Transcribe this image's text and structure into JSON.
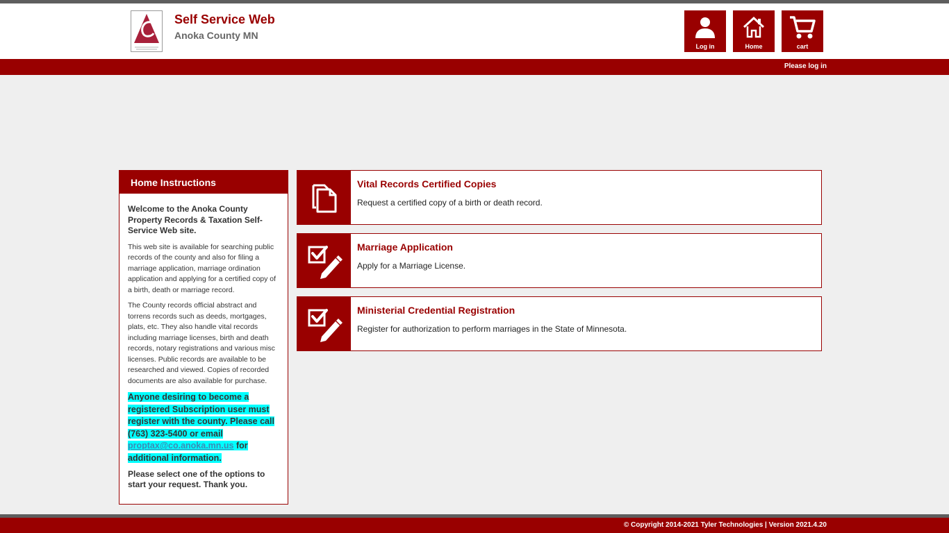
{
  "header": {
    "logo_text": "ANOKA COUNTY",
    "title": "Self Service Web",
    "subtitle": "Anoka County MN"
  },
  "nav": {
    "login": {
      "label": "Log in",
      "icon": "user-icon"
    },
    "home": {
      "label": "Home",
      "icon": "home-icon"
    },
    "cart": {
      "label": "cart",
      "icon": "cart-icon"
    }
  },
  "status": {
    "login_prompt": "Please log in"
  },
  "instructions": {
    "heading": "Home Instructions",
    "welcome": "Welcome to the Anoka County Property Records & Taxation Self-Service Web site.",
    "para1": "This web site is available for searching public records of the county and also for filing a marriage application, marriage ordination application and applying for a certified copy of a birth, death or marriage record.",
    "para2": "The County records official abstract and torrens records such as deeds, mortgages, plats, etc. They also handle vital records including marriage licenses, birth and death records, notary registrations and various misc licenses. Public records are available to be researched and viewed. Copies of recorded documents are also available for purchase.",
    "highlight_before": "Anyone desiring to become a registered Subscription user must register with the county. Please call (763) 323-5400 or email",
    "email": "proptax@co.anoka.mn.us",
    "highlight_after": "for additional information.",
    "closing": "Please select one of the options to start your request. Thank you."
  },
  "cards": [
    {
      "title": "Vital Records Certified Copies",
      "description": "Request a certified copy of a birth or death record.",
      "icon": "documents-icon"
    },
    {
      "title": "Marriage Application",
      "description": "Apply for a Marriage License.",
      "icon": "checkbox-pencil-icon"
    },
    {
      "title": "Ministerial Credential Registration",
      "description": "Register for authorization to perform marriages in the State of Minnesota.",
      "icon": "checkbox-pencil-icon"
    }
  ],
  "footer": {
    "copyright": "© Copyright 2014-2021 Tyler Technologies | Version 2021.4.20"
  },
  "colors": {
    "brand_red": "#990000",
    "highlight": "#00ffff",
    "background": "#efefef",
    "stripe_gray": "#5e5e5e"
  }
}
